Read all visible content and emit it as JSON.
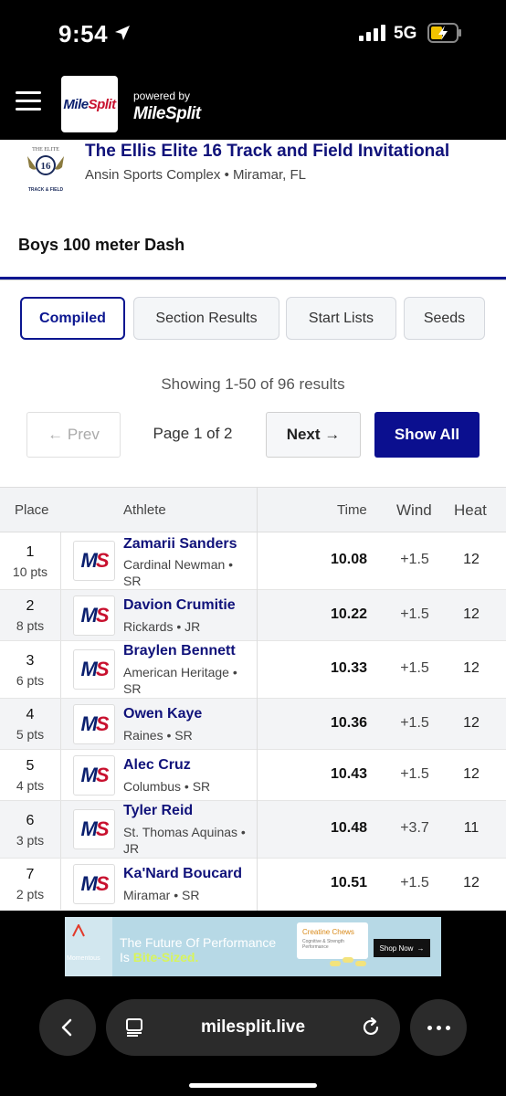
{
  "status_bar": {
    "time": "9:54",
    "network": "5G"
  },
  "header": {
    "logo_text_a": "Mile",
    "logo_text_b": "Split",
    "powered_by": "powered by",
    "powered_brand": "MileSplit"
  },
  "meet": {
    "title": "The Ellis Elite 16 Track and Field Invitational",
    "venue": "Ansin Sports Complex • Miramar, FL",
    "logo_top": "THE ELITE",
    "logo_num": "16",
    "logo_bottom": "TRACK & FIELD"
  },
  "event": {
    "title": "Boys 100 meter Dash"
  },
  "tabs": [
    {
      "label": "Compiled"
    },
    {
      "label": "Section Results"
    },
    {
      "label": "Start Lists"
    },
    {
      "label": "Seeds"
    }
  ],
  "pagination": {
    "count_text": "Showing 1-50 of 96 results",
    "prev_label": "← Prev",
    "page_label": "Page 1 of 2",
    "next_label": "Next →",
    "show_all_label": "Show All"
  },
  "table": {
    "headers": {
      "place": "Place",
      "athlete": "Athlete",
      "time": "Time",
      "wind": "Wind",
      "heat": "Heat"
    },
    "rows": [
      {
        "place": "1",
        "pts": "10 pts",
        "name": "Zamarii Sanders",
        "school": "Cardinal Newman • SR",
        "time": "10.08",
        "wind": "+1.5",
        "heat": "12"
      },
      {
        "place": "2",
        "pts": "8 pts",
        "name": "Davion Crumitie",
        "school": "Rickards • JR",
        "time": "10.22",
        "wind": "+1.5",
        "heat": "12"
      },
      {
        "place": "3",
        "pts": "6 pts",
        "name": "Braylen Bennett",
        "school": "American Heritage • SR",
        "time": "10.33",
        "wind": "+1.5",
        "heat": "12"
      },
      {
        "place": "4",
        "pts": "5 pts",
        "name": "Owen Kaye",
        "school": "Raines • SR",
        "time": "10.36",
        "wind": "+1.5",
        "heat": "12"
      },
      {
        "place": "5",
        "pts": "4 pts",
        "name": "Alec Cruz",
        "school": "Columbus • SR",
        "time": "10.43",
        "wind": "+1.5",
        "heat": "12"
      },
      {
        "place": "6",
        "pts": "3 pts",
        "name": "Tyler Reid",
        "school": "St. Thomas Aquinas • JR",
        "time": "10.48",
        "wind": "+3.7",
        "heat": "11"
      },
      {
        "place": "7",
        "pts": "2 pts",
        "name": "Ka'Nard Boucard",
        "school": "Miramar • SR",
        "time": "10.51",
        "wind": "+1.5",
        "heat": "12"
      }
    ],
    "ms_logo_a": "M",
    "ms_logo_b": "S"
  },
  "ad": {
    "brand": "Momentous",
    "headline_1": "The Future Of Performance",
    "headline_2a": "Is ",
    "headline_2b": "Bite-Sized.",
    "product": "Creatine Chews",
    "product_sub": "Cognitive & Strength Performance",
    "cta": "Shop Now",
    "cta_arrow": "→"
  },
  "browser": {
    "url": "milesplit.live"
  },
  "colors": {
    "brand_blue": "#0b1690",
    "button_blue": "#0b0f8f",
    "name_blue": "#10127a",
    "brand_red": "#c8102e"
  }
}
